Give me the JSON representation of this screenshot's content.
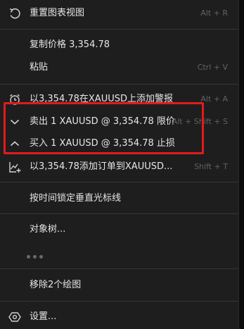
{
  "menu": {
    "items": [
      {
        "id": "reset",
        "label": "重置图表视图",
        "shortcut": "Alt + R",
        "icon": "reset-icon"
      },
      {
        "id": "copy",
        "label": "复制价格 3,354.78",
        "shortcut": "",
        "icon": ""
      },
      {
        "id": "paste",
        "label": "粘贴",
        "shortcut": "Ctrl + V",
        "icon": ""
      },
      {
        "id": "alert",
        "label": "以3,354.78在XAUUSD上添加警报",
        "shortcut": "Alt + A",
        "icon": "alarm-clock-icon"
      },
      {
        "id": "sell",
        "label": "卖出 1 XAUUSD @ 3,354.78 限价",
        "shortcut": "Alt + Shift + S",
        "icon": "chevron-down-icon"
      },
      {
        "id": "buy",
        "label": "买入 1 XAUUSD @ 3,354.78 止损",
        "shortcut": "",
        "icon": "chevron-up-icon"
      },
      {
        "id": "order",
        "label": "以3,354.78添加订单到XAUUSD...",
        "shortcut": "Shift + T",
        "icon": "order-chart-icon"
      },
      {
        "id": "lock",
        "label": "按时间锁定垂直光标线",
        "shortcut": "",
        "icon": ""
      },
      {
        "id": "tree",
        "label": "对象树...",
        "shortcut": "",
        "icon": ""
      },
      {
        "id": "remove",
        "label": "移除2个绘图",
        "shortcut": "",
        "icon": ""
      },
      {
        "id": "settings",
        "label": "设置...",
        "shortcut": "",
        "icon": "settings-gear-icon"
      }
    ]
  },
  "colors": {
    "background": "#1e1e1e",
    "text": "#e6e6e6",
    "shortcut": "#626262",
    "separator": "#363636",
    "highlight": "#e21b1b"
  }
}
